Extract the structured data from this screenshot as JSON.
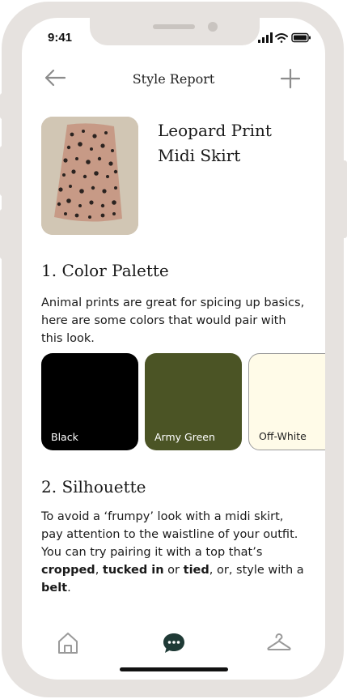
{
  "status_bar": {
    "time": "9:41"
  },
  "header": {
    "title": "Style Report"
  },
  "product": {
    "name_line1": "Leopard Print",
    "name_line2": "Midi Skirt"
  },
  "color_palette": {
    "heading": "1. Color Palette",
    "description": "Animal prints are great for spicing up basics, here are some colors that would pair with this look.",
    "swatches": [
      {
        "label": "Black",
        "color": "#000000",
        "text_color": "#ffffff"
      },
      {
        "label": "Army Green",
        "color": "#4b5425",
        "text_color": "#ffffff"
      },
      {
        "label": "Off-White",
        "color": "#fffbe8",
        "text_color": "#222222"
      }
    ]
  },
  "silhouette": {
    "heading": "2. Silhouette",
    "text_1": "To avoid a ‘frumpy’ look with a midi skirt, pay attention to the waistline of your outfit. You can try pairing it with a top that’s ",
    "bold_1": "cropped",
    "text_2": ", ",
    "bold_2": "tucked in",
    "text_3": " or ",
    "bold_3": "tied",
    "text_4": ", or, style with a ",
    "bold_4": "belt",
    "text_5": "."
  },
  "nav": {
    "items": [
      {
        "icon": "home-icon",
        "active": false
      },
      {
        "icon": "chat-bubble-icon",
        "active": true
      },
      {
        "icon": "hanger-icon",
        "active": false
      }
    ],
    "active_color": "#1f3a36",
    "inactive_color": "#9a9a9a"
  }
}
